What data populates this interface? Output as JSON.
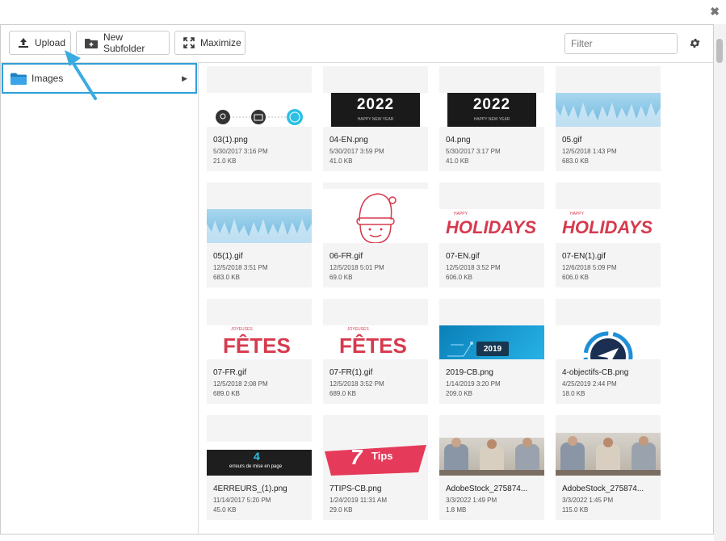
{
  "toolbar": {
    "upload_label": "Upload",
    "new_subfolder_label": "New Subfolder",
    "maximize_label": "Maximize",
    "filter_placeholder": "Filter"
  },
  "sidebar": {
    "folders": [
      {
        "label": "Images"
      }
    ]
  },
  "colors": {
    "accent": "#2d9fd9",
    "holiday_red": "#d63a4e"
  },
  "files": [
    {
      "name": "03(1).png",
      "date": "5/30/2017 3:16 PM",
      "size": "21.0 KB"
    },
    {
      "name": "04-EN.png",
      "date": "5/30/2017 3:59 PM",
      "size": "41.0 KB",
      "thumb_text": "2022",
      "thumb_sub": "HAPPY NEW YEAR"
    },
    {
      "name": "04.png",
      "date": "5/30/2017 3:17 PM",
      "size": "41.0 KB",
      "thumb_text": "2022",
      "thumb_sub": "HAPPY NEW YEAR"
    },
    {
      "name": "05.gif",
      "date": "12/5/2018 1:43 PM",
      "size": "683.0 KB"
    },
    {
      "name": "05(1).gif",
      "date": "12/5/2018 3:51 PM",
      "size": "683.0 KB"
    },
    {
      "name": "06-FR.gif",
      "date": "12/5/2018 5:01 PM",
      "size": "69.0 KB"
    },
    {
      "name": "07-EN.gif",
      "date": "12/5/2018 3:52 PM",
      "size": "606.0 KB",
      "thumb_text": "HOLIDAYS",
      "thumb_sub": "HAPPY"
    },
    {
      "name": "07-EN(1).gif",
      "date": "12/6/2018 5:09 PM",
      "size": "606.0 KB",
      "thumb_text": "HOLIDAYS",
      "thumb_sub": "HAPPY"
    },
    {
      "name": "07-FR.gif",
      "date": "12/5/2018 2:08 PM",
      "size": "689.0 KB",
      "thumb_text": "FÊTES",
      "thumb_sub": "JOYEUSES"
    },
    {
      "name": "07-FR(1).gif",
      "date": "12/5/2018 3:52 PM",
      "size": "689.0 KB",
      "thumb_text": "FÊTES",
      "thumb_sub": "JOYEUSES"
    },
    {
      "name": "2019-CB.png",
      "date": "1/14/2019 3:20 PM",
      "size": "209.0 KB",
      "thumb_text": "2019"
    },
    {
      "name": "4-objectifs-CB.png",
      "date": "4/25/2019 2:44 PM",
      "size": "18.0 KB"
    },
    {
      "name": "4ERREURS_(1).png",
      "date": "11/14/2017 5:20 PM",
      "size": "45.0 KB",
      "thumb_text": "4",
      "thumb_sub": "erreurs de mise en page"
    },
    {
      "name": "7TIPS-CB.png",
      "date": "1/24/2019 11:31 AM",
      "size": "29.0 KB",
      "thumb_text": "7",
      "thumb_sub": "Tips"
    },
    {
      "name": "AdobeStock_275874...",
      "date": "3/3/2022 1:49 PM",
      "size": "1.8 MB"
    },
    {
      "name": "AdobeStock_275874...",
      "date": "3/3/2022 1:45 PM",
      "size": "115.0 KB"
    }
  ]
}
